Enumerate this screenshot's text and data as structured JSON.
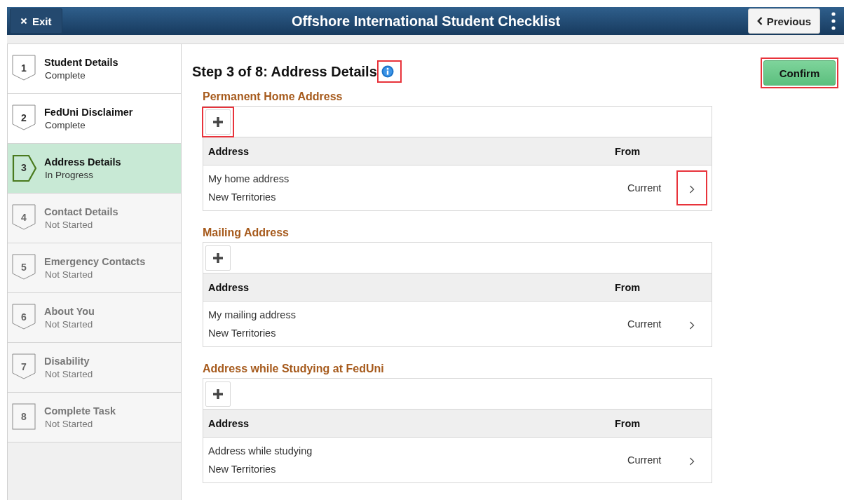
{
  "header": {
    "exit_label": "Exit",
    "title": "Offshore International Student Checklist",
    "previous_label": "Previous"
  },
  "steps": [
    {
      "number": "1",
      "title": "Student Details",
      "status": "Complete",
      "kind": "complete",
      "selected": false
    },
    {
      "number": "2",
      "title": "FedUni Disclaimer",
      "status": "Complete",
      "kind": "complete",
      "selected": false
    },
    {
      "number": "3",
      "title": "Address Details",
      "status": "In Progress",
      "kind": "progress",
      "selected": true
    },
    {
      "number": "4",
      "title": "Contact Details",
      "status": "Not Started",
      "kind": "pending",
      "selected": false
    },
    {
      "number": "5",
      "title": "Emergency Contacts",
      "status": "Not Started",
      "kind": "pending",
      "selected": false
    },
    {
      "number": "6",
      "title": "About You",
      "status": "Not Started",
      "kind": "pending",
      "selected": false
    },
    {
      "number": "7",
      "title": "Disability",
      "status": "Not Started",
      "kind": "pending",
      "selected": false
    },
    {
      "number": "8",
      "title": "Complete Task",
      "status": "Not Started",
      "kind": "pending",
      "selected": false
    }
  ],
  "page": {
    "heading": "Step 3 of 8: Address Details",
    "info_highlighted": true,
    "confirm_label": "Confirm",
    "confirm_highlighted": true
  },
  "sections": [
    {
      "title": "Permanent Home Address",
      "add_highlighted": true,
      "columns": [
        "Address",
        "From"
      ],
      "rows": [
        {
          "lines": [
            "My home address",
            "New Territories"
          ],
          "from": "Current",
          "highlighted": true
        }
      ]
    },
    {
      "title": "Mailing Address",
      "add_highlighted": false,
      "columns": [
        "Address",
        "From"
      ],
      "rows": [
        {
          "lines": [
            "My mailing address",
            "New Territories"
          ],
          "from": "Current",
          "highlighted": false
        }
      ]
    },
    {
      "title": "Address while Studying at FedUni",
      "add_highlighted": false,
      "columns": [
        "Address",
        "From"
      ],
      "rows": [
        {
          "lines": [
            "Address while studying",
            "New Territories"
          ],
          "from": "Current",
          "highlighted": false
        }
      ]
    }
  ]
}
